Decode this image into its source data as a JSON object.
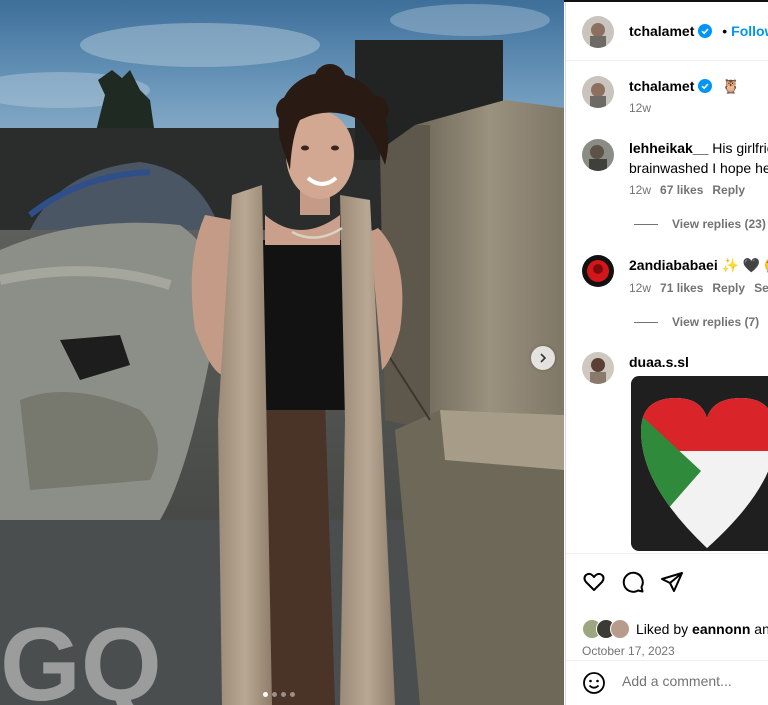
{
  "post": {
    "photo_watermark": "GQ",
    "carousel": {
      "total": 4,
      "active": 1
    }
  },
  "header": {
    "username": "tchalamet",
    "separator": "•",
    "follow_label": "Follow"
  },
  "caption": {
    "username": "tchalamet",
    "emoji": "🦉",
    "time": "12w"
  },
  "comments": [
    {
      "username": "lehheikak__",
      "text_line1": "His girlfriend",
      "text_line2": "brainwashed I hope he",
      "time": "12w",
      "likes": "67 likes",
      "reply_label": "Reply",
      "view_replies": "View replies (23)"
    },
    {
      "username": "2andiababaei",
      "emojis": "✨ 🖤 😭",
      "time": "12w",
      "likes": "71 likes",
      "reply_label": "Reply",
      "see_label": "See",
      "view_replies": "View replies (7)"
    },
    {
      "username": "duaa.s.sl",
      "image": "palestine-heart-flag"
    }
  ],
  "actions": {
    "liked_by_prefix": "Liked by",
    "liked_by_user": "eannonn",
    "liked_by_suffix": "and",
    "date": "October 17, 2023"
  },
  "composer": {
    "placeholder": "Add a comment...",
    "emoji_icon": "smiley-icon"
  },
  "colors": {
    "follow_blue": "#0095f6",
    "verified_blue": "#0095f6",
    "muted_text": "#737373"
  }
}
